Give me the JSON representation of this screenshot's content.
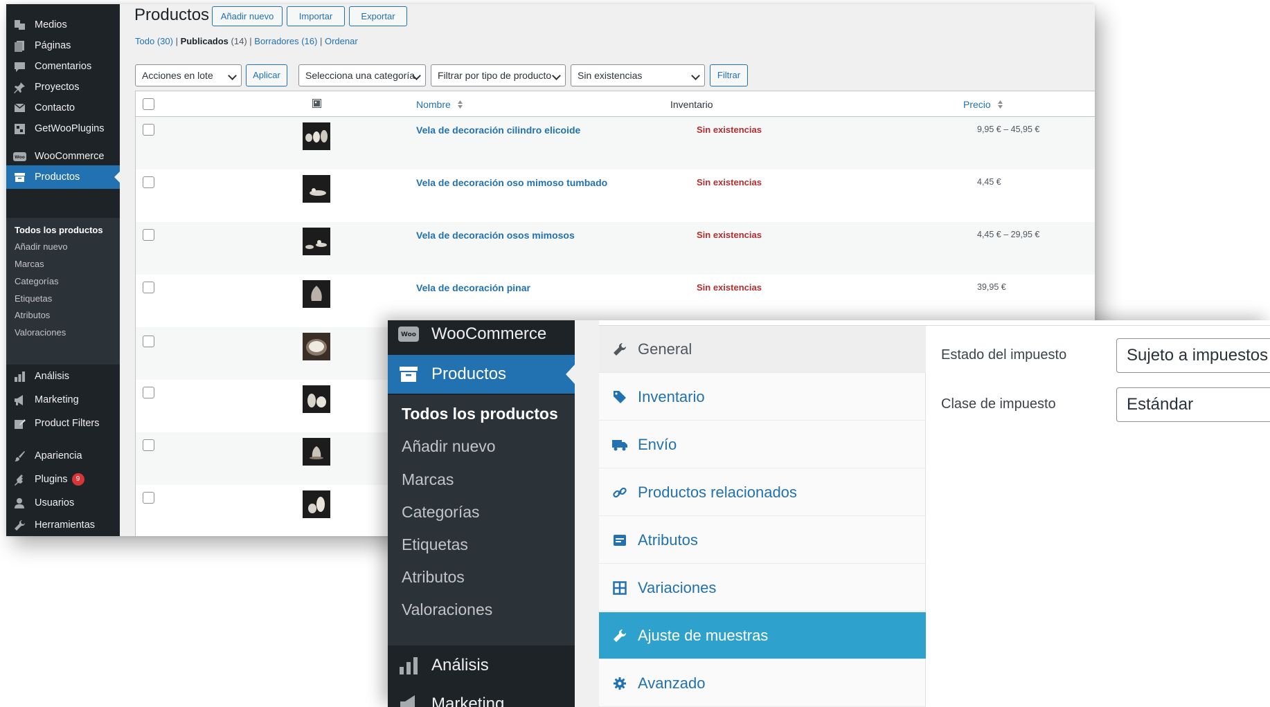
{
  "back_window": {
    "sidebar": {
      "items": [
        {
          "label": "Medios",
          "icon": "media-icon"
        },
        {
          "label": "Páginas",
          "icon": "pages-icon"
        },
        {
          "label": "Comentarios",
          "icon": "comment-icon"
        },
        {
          "label": "Proyectos",
          "icon": "pin-icon"
        },
        {
          "label": "Contacto",
          "icon": "mail-icon"
        },
        {
          "label": "GetWooPlugins",
          "icon": "plugin-grid-icon"
        },
        {
          "label": "WooCommerce",
          "icon": "woo-icon"
        },
        {
          "label": "Productos",
          "icon": "archive-icon"
        },
        {
          "label": "Análisis",
          "icon": "bar-chart-icon"
        },
        {
          "label": "Marketing",
          "icon": "megaphone-icon"
        },
        {
          "label": "Product Filters",
          "icon": "edit-icon"
        },
        {
          "label": "Apariencia",
          "icon": "brush-icon"
        },
        {
          "label": "Plugins",
          "icon": "plugin-icon",
          "badge": "9"
        },
        {
          "label": "Usuarios",
          "icon": "user-icon"
        },
        {
          "label": "Herramientas",
          "icon": "wrench-icon"
        }
      ],
      "submenu": [
        "Todos los productos",
        "Añadir nuevo",
        "Marcas",
        "Categorías",
        "Etiquetas",
        "Atributos",
        "Valoraciones"
      ]
    },
    "header": {
      "title": "Productos",
      "add_new": "Añadir nuevo",
      "import": "Importar",
      "export": "Exportar"
    },
    "views": {
      "all": "Todo",
      "all_count": "(30)",
      "published": "Publicados",
      "published_count": "(14)",
      "drafts": "Borradores",
      "drafts_count": "(16)",
      "sort": "Ordenar",
      "separator": " | "
    },
    "filters": {
      "bulk_actions": "Acciones en lote",
      "apply": "Aplicar",
      "category": "Selecciona una categoría",
      "product_type": "Filtrar por tipo de producto",
      "stock": "Sin existencias",
      "filter": "Filtrar"
    },
    "table": {
      "col_name": "Nombre",
      "col_inventory": "Inventario",
      "col_price": "Precio",
      "rows": [
        {
          "name": "Vela de decoración cilindro elicoide",
          "stock": "Sin existencias",
          "price": "9,95 € – 45,95 €"
        },
        {
          "name": "Vela de decoración oso mimoso tumbado",
          "stock": "Sin existencias",
          "price": "4,45 €"
        },
        {
          "name": "Vela de decoración osos mimosos",
          "stock": "Sin existencias",
          "price": "4,45 € – 29,95 €"
        },
        {
          "name": "Vela de decoración pinar",
          "stock": "Sin existencias",
          "price": "39,95 €"
        }
      ]
    }
  },
  "front_window": {
    "sidebar": {
      "woocommerce": "WooCommerce",
      "products": "Productos",
      "submenu": [
        "Todos los productos",
        "Añadir nuevo",
        "Marcas",
        "Categorías",
        "Etiquetas",
        "Atributos",
        "Valoraciones"
      ],
      "analytics": "Análisis",
      "marketing": "Marketing"
    },
    "tabs": [
      {
        "label": "General",
        "icon": "wrench-icon"
      },
      {
        "label": "Inventario",
        "icon": "tag-icon"
      },
      {
        "label": "Envío",
        "icon": "truck-icon"
      },
      {
        "label": "Productos relacionados",
        "icon": "link-icon"
      },
      {
        "label": "Atributos",
        "icon": "list-card-icon"
      },
      {
        "label": "Variaciones",
        "icon": "grid-icon"
      },
      {
        "label": "Ajuste de muestras",
        "icon": "wrench-icon"
      },
      {
        "label": "Avanzado",
        "icon": "gear-icon"
      }
    ],
    "selected_tab": "Ajuste de muestras",
    "fields": {
      "tax_status_label": "Estado del impuesto",
      "tax_status_value": "Sujeto a impuestos",
      "tax_class_label": "Clase de impuesto",
      "tax_class_value": "Estándar"
    }
  },
  "colors": {
    "sidebar_bg": "#1d2327",
    "submenu_bg": "#2c3338",
    "accent": "#2271b1",
    "out_of_stock": "#b32d2e",
    "selected_tab": "#2ea2cc",
    "badge": "#d63638"
  }
}
